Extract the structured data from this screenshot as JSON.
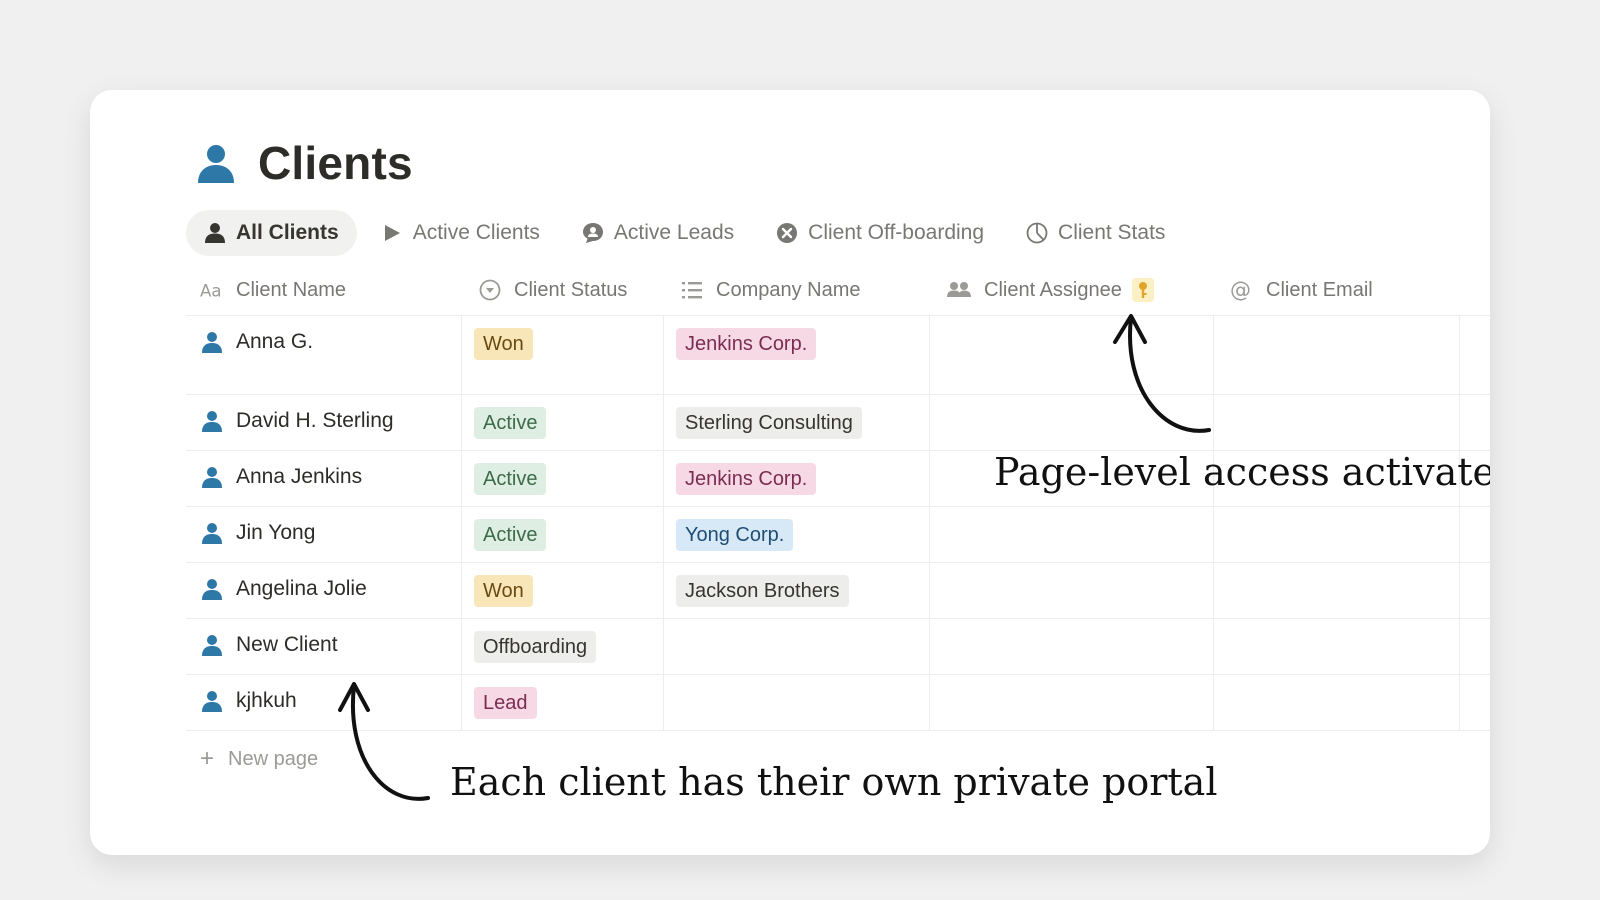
{
  "page": {
    "title": "Clients",
    "title_icon": "person-icon"
  },
  "tabs": [
    {
      "label": "All Clients",
      "icon": "person-icon",
      "active": true
    },
    {
      "label": "Active Clients",
      "icon": "play-icon",
      "active": false
    },
    {
      "label": "Active Leads",
      "icon": "chat-bubble-icon",
      "active": false
    },
    {
      "label": "Client Off-boarding",
      "icon": "x-circle-icon",
      "active": false
    },
    {
      "label": "Client Stats",
      "icon": "pie-chart-icon",
      "active": false
    }
  ],
  "columns": [
    {
      "label": "Client Name",
      "icon": "text-aa-icon"
    },
    {
      "label": "Client Status",
      "icon": "status-icon"
    },
    {
      "label": "Company Name",
      "icon": "list-icon"
    },
    {
      "label": "Client Assignee",
      "icon": "people-icon",
      "badge_icon": "key-icon"
    },
    {
      "label": "Client Email",
      "icon": "at-icon"
    }
  ],
  "rows": [
    {
      "name": "Anna G.",
      "status": "Won",
      "company": "Jenkins Corp."
    },
    {
      "name": "David H. Sterling",
      "status": "Active",
      "company": "Sterling Consulting"
    },
    {
      "name": "Anna Jenkins",
      "status": "Active",
      "company": "Jenkins Corp."
    },
    {
      "name": "Jin Yong",
      "status": "Active",
      "company": "Yong Corp."
    },
    {
      "name": "Angelina Jolie",
      "status": "Won",
      "company": "Jackson Brothers"
    },
    {
      "name": "New Client",
      "status": "Offboarding",
      "company": ""
    },
    {
      "name": "kjhkuh",
      "status": "Lead",
      "company": ""
    }
  ],
  "new_page_label": "New page",
  "status_colors": {
    "Won": {
      "bg": "#f9e6b8",
      "fg": "#6b4a12"
    },
    "Active": {
      "bg": "#dfeee3",
      "fg": "#3d6b4a"
    },
    "Offboarding": {
      "bg": "#ededeb",
      "fg": "#37352f"
    },
    "Lead": {
      "bg": "#f7d9e6",
      "fg": "#7a2d50"
    }
  },
  "company_colors": {
    "Jenkins Corp.": {
      "bg": "#f7d9e6",
      "fg": "#7a2d50"
    },
    "Sterling Consulting": {
      "bg": "#ededeb",
      "fg": "#37352f"
    },
    "Yong Corp.": {
      "bg": "#d7e9f7",
      "fg": "#1f4e75"
    },
    "Jackson Brothers": {
      "bg": "#ededeb",
      "fg": "#37352f"
    }
  },
  "accent_color": "#2e78a8",
  "annotations": {
    "assignee_note": "Page-level access activated",
    "portal_note": "Each client has their own private portal"
  }
}
